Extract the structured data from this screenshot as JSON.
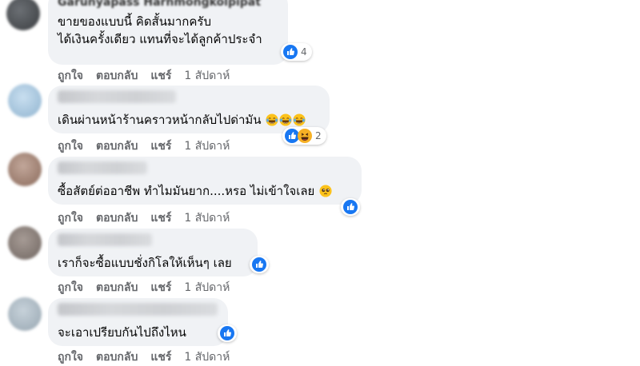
{
  "comments": [
    {
      "author": "Garunyapass Harnmongkolpipat",
      "text_lines": [
        "ขายของแบบนี้ คิดสั้นมากครับ",
        "ได้เงินครั้งเดียว แทนที่จะได้ลูกค้าประจำ"
      ],
      "reaction_count": "4",
      "reaction_icons": [
        "like-icon"
      ],
      "actions": {
        "like": "ถูกใจ",
        "reply": "ตอบกลับ",
        "share": "แชร์",
        "time": "1 สัปดาห์"
      }
    },
    {
      "text": "เดินผ่านหน้าร้านคราวหน้ากลับไปด่ามัน",
      "text_emoji": [
        "laughing-face-icon",
        "laughing-face-icon",
        "laughing-face-icon"
      ],
      "reaction_count": "2",
      "reaction_icons": [
        "like-icon",
        "haha-icon"
      ],
      "actions": {
        "like": "ถูกใจ",
        "reply": "ตอบกลับ",
        "share": "แชร์",
        "time": "1 สัปดาห์"
      }
    },
    {
      "text": "ซื้อสัตย์ต่ออาชีพ ทำไมมันยาก....หรอ ไม่เข้าใจเลย",
      "text_emoji": [
        "pleading-face-icon"
      ],
      "reaction_icons": [
        "like-icon"
      ],
      "actions": {
        "like": "ถูกใจ",
        "reply": "ตอบกลับ",
        "share": "แชร์",
        "time": "1 สัปดาห์"
      }
    },
    {
      "text": "เราก็จะซื้อแบบชั่งกิโลให้เห็นๆ เลย",
      "reaction_icons": [
        "like-icon"
      ],
      "actions": {
        "like": "ถูกใจ",
        "reply": "ตอบกลับ",
        "share": "แชร์",
        "time": "1 สัปดาห์"
      }
    },
    {
      "text": "จะเอาเปรียบกันไปถึงไหน",
      "reaction_icons": [
        "like-icon"
      ],
      "actions": {
        "like": "ถูกใจ",
        "reply": "ตอบกลับ",
        "share": "แชร์",
        "time": "1 สัปดาห์"
      }
    }
  ],
  "colors": {
    "bubble": "#f0f2f5",
    "meta_text": "#65676b",
    "like_blue": "#1877f2",
    "haha_yellow": "#f7b125"
  }
}
